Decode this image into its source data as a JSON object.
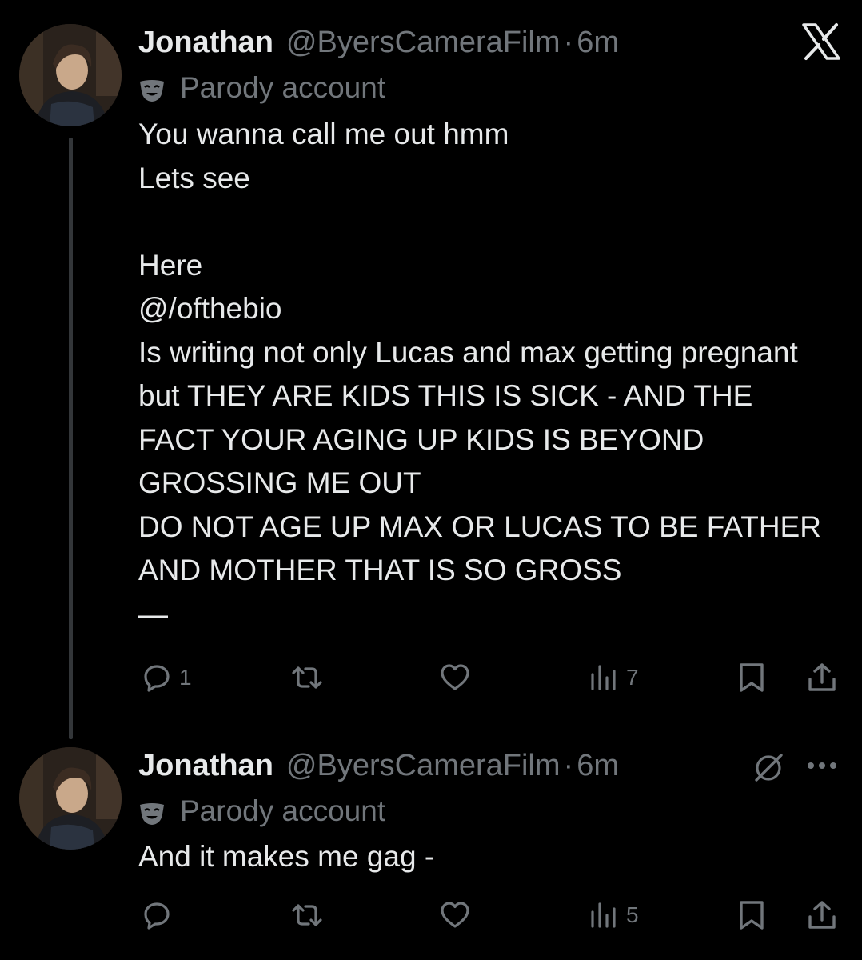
{
  "tweets": [
    {
      "author_name": "Jonathan",
      "handle": "@ByersCameraFilm",
      "separator": "·",
      "time": "6m",
      "label": "Parody account",
      "text": "You wanna call me out hmm\nLets see\n\nHere\n@/ofthebio\nIs writing not only Lucas and max getting pregnant but THEY ARE KIDS THIS IS SICK - AND THE FACT YOUR AGING UP KIDS IS BEYOND GROSSING ME OUT\nDO NOT AGE UP MAX OR LUCAS TO BE FATHER AND MOTHER THAT IS SO GROSS\n—",
      "replies": "1",
      "reposts": "",
      "likes": "",
      "views": "7",
      "top_right_icon": "x-logo-icon"
    },
    {
      "author_name": "Jonathan",
      "handle": "@ByersCameraFilm",
      "separator": "·",
      "time": "6m",
      "label": "Parody account",
      "text": "And it makes me gag -",
      "replies": "",
      "reposts": "",
      "likes": "",
      "views": "5",
      "top_right_icons": [
        "grok-icon",
        "more-icon"
      ]
    }
  ],
  "colors": {
    "background": "#000000",
    "text": "#e7e9ea",
    "secondary": "#71767b",
    "thread_line": "#333639"
  }
}
